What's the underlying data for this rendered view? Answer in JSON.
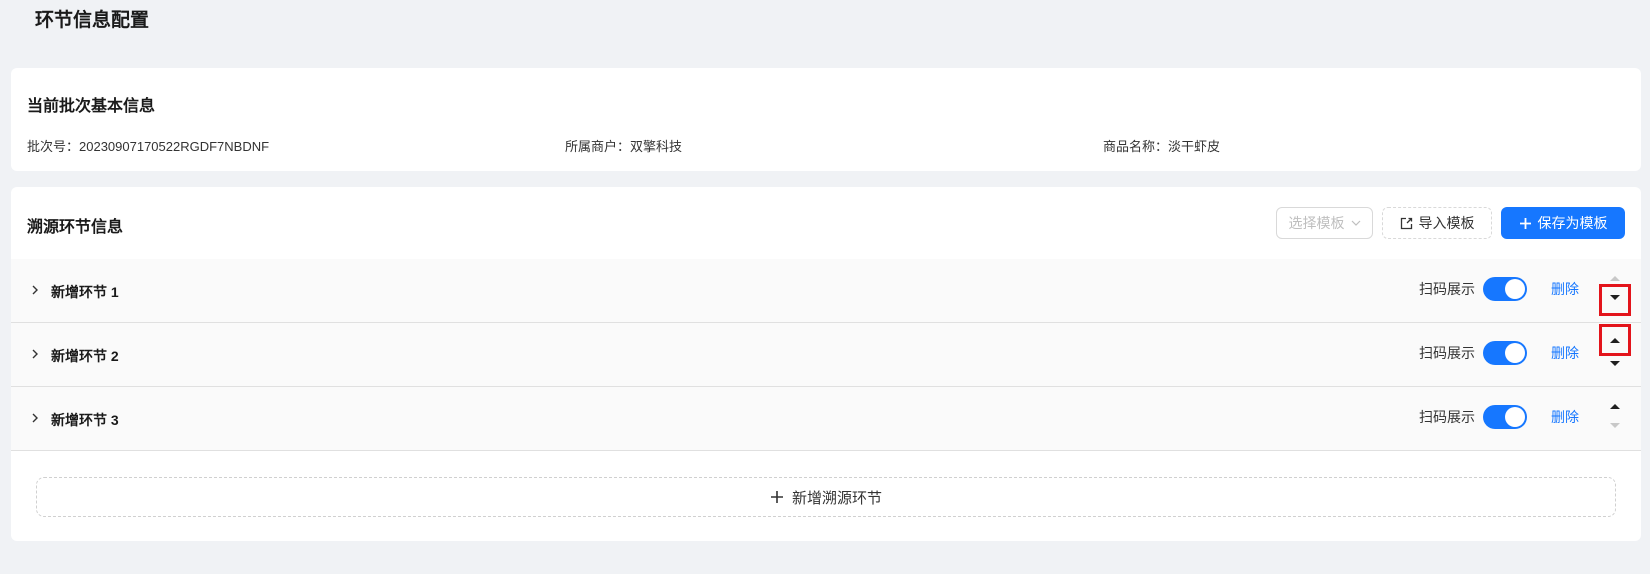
{
  "page": {
    "title": "环节信息配置"
  },
  "basic_info": {
    "title": "当前批次基本信息",
    "batch": "批次号：20230907170522RGDF7NBDNF",
    "merchant": "所属商户：双擎科技",
    "product": "商品名称：淡干虾皮"
  },
  "trace": {
    "title": "溯源环节信息",
    "select_template": "选择模板",
    "import_template": "导入模板",
    "save_as_template": "保存为模板",
    "add_step": "新增溯源环节",
    "scan_label": "扫码展示",
    "delete_label": "删除",
    "steps": [
      {
        "name": "新增环节 1",
        "scan_display": true
      },
      {
        "name": "新增环节 2",
        "scan_display": true
      },
      {
        "name": "新增环节 3",
        "scan_display": true
      }
    ]
  },
  "colors": {
    "primary": "#1677ff",
    "highlight_box": "#e3141b",
    "disabled_arrow": "#c8c8c8",
    "active_arrow": "#1f1f1f"
  },
  "icons": [
    "chevron-right-icon",
    "chevron-down-icon",
    "external-link-icon",
    "plus-icon",
    "arrow-up-icon",
    "arrow-down-icon"
  ]
}
